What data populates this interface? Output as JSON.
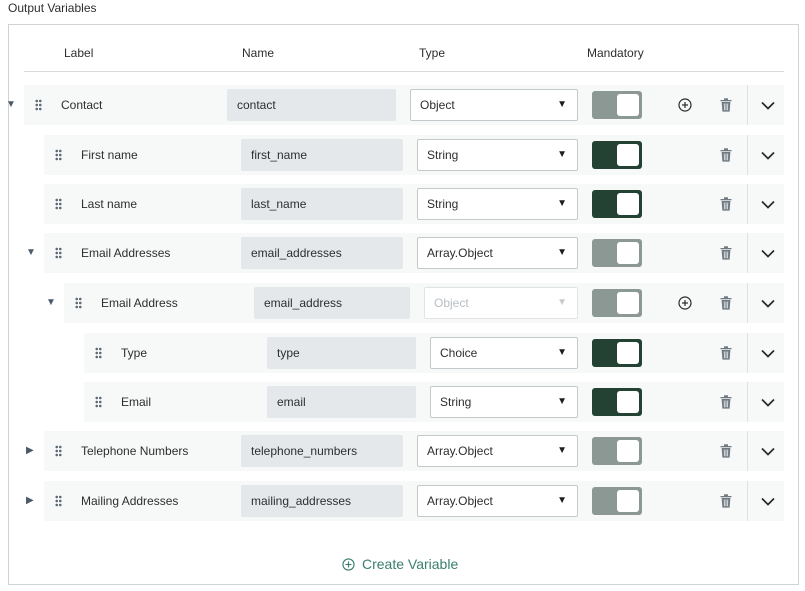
{
  "section_title": "Output Variables",
  "columns": {
    "label": "Label",
    "name": "Name",
    "type": "Type",
    "mandatory": "Mandatory"
  },
  "rows": [
    {
      "label": "Contact",
      "name": "contact",
      "type": "Object",
      "mandatory": false,
      "expander": "expanded",
      "add_child": true,
      "type_disabled": false
    },
    {
      "label": "First name",
      "name": "first_name",
      "type": "String",
      "mandatory": true,
      "expander": "none",
      "add_child": false,
      "type_disabled": false
    },
    {
      "label": "Last name",
      "name": "last_name",
      "type": "String",
      "mandatory": true,
      "expander": "none",
      "add_child": false,
      "type_disabled": false
    },
    {
      "label": "Email Addresses",
      "name": "email_addresses",
      "type": "Array.Object",
      "mandatory": false,
      "expander": "expanded",
      "add_child": false,
      "type_disabled": false
    },
    {
      "label": "Email Address",
      "name": "email_address",
      "type": "Object",
      "mandatory": false,
      "expander": "expanded",
      "add_child": true,
      "type_disabled": true
    },
    {
      "label": "Type",
      "name": "type",
      "type": "Choice",
      "mandatory": true,
      "expander": "none",
      "add_child": false,
      "type_disabled": false
    },
    {
      "label": "Email",
      "name": "email",
      "type": "String",
      "mandatory": true,
      "expander": "none",
      "add_child": false,
      "type_disabled": false
    },
    {
      "label": "Telephone Numbers",
      "name": "telephone_numbers",
      "type": "Array.Object",
      "mandatory": false,
      "expander": "collapsed",
      "add_child": false,
      "type_disabled": false
    },
    {
      "label": "Mailing Addresses",
      "name": "mailing_addresses",
      "type": "Array.Object",
      "mandatory": false,
      "expander": "collapsed",
      "add_child": false,
      "type_disabled": false
    }
  ],
  "create_variable_label": "Create Variable",
  "colors": {
    "toggle_on": "#234234",
    "toggle_off": "#8c9893",
    "accent": "#3a7f6d"
  }
}
